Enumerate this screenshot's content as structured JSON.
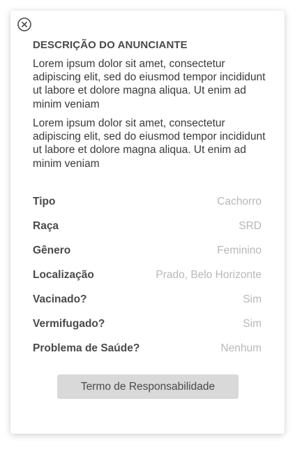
{
  "icons": {
    "close": "close-icon"
  },
  "advertiser": {
    "title": "DESCRIÇÃO DO ANUNCIANTE",
    "paragraphs": [
      "Lorem ipsum dolor sit amet, consectetur adipiscing elit, sed do eiusmod tempor incididunt ut labore et dolore magna aliqua. Ut enim ad minim veniam",
      "Lorem ipsum dolor sit amet, consectetur adipiscing elit, sed do eiusmod tempor incididunt ut labore et dolore magna aliqua. Ut enim ad minim veniam"
    ]
  },
  "details": [
    {
      "label": "Tipo",
      "value": "Cachorro"
    },
    {
      "label": "Raça",
      "value": "SRD"
    },
    {
      "label": "Gênero",
      "value": "Feminino"
    },
    {
      "label": "Localização",
      "value": "Prado, Belo Horizonte"
    },
    {
      "label": "Vacinado?",
      "value": "Sim"
    },
    {
      "label": "Vermifugado?",
      "value": "Sim"
    },
    {
      "label": "Problema de Saúde?",
      "value": "Nenhum"
    }
  ],
  "actions": {
    "terms_label": "Termo de Responsabilidade"
  },
  "colors": {
    "card_bg": "#ffffff",
    "title_text": "#4a4a4a",
    "body_text": "#3a3a3a",
    "value_text": "#b8b8b8",
    "button_bg": "#d9d9d9"
  }
}
